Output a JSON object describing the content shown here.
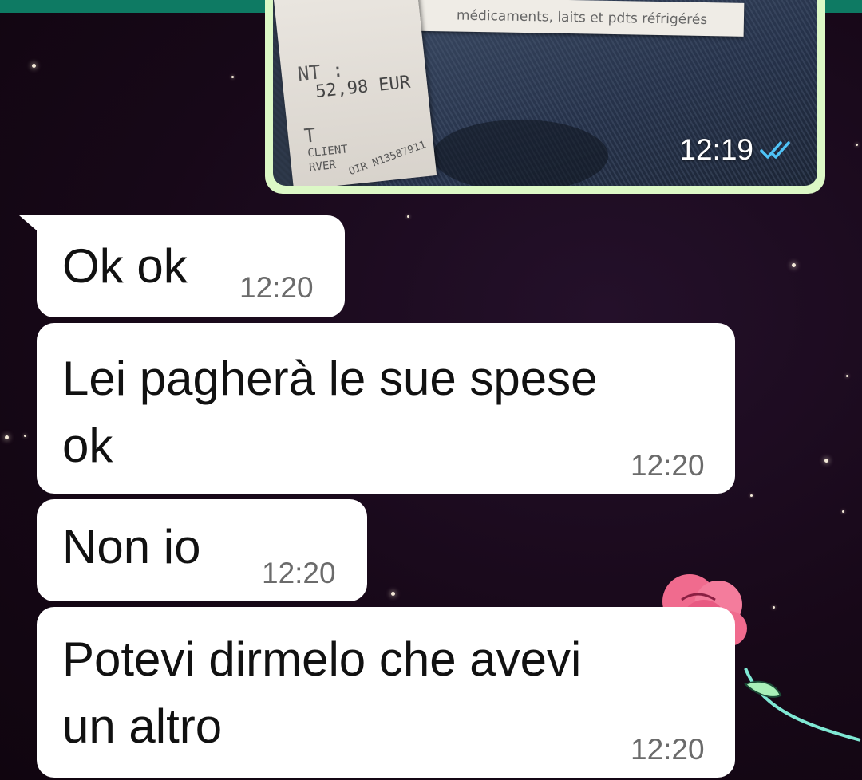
{
  "image_message": {
    "time": "12:19",
    "read_receipt_icon": "double-check-icon",
    "read_receipt_color": "#4fc3f7",
    "receipt_text": {
      "amount": "52,98 EUR",
      "label_nt": "NT :",
      "label_t": "T",
      "label_client": "CLIENT",
      "label_server": "RVER",
      "serial": "OIR N13587911",
      "footer": "médicaments, laits et pdts réfrigérés"
    }
  },
  "messages": [
    {
      "text_lines": [
        "Ok ok"
      ],
      "time": "12:20"
    },
    {
      "text_lines": [
        "Lei pagherà le sue spese",
        "ok"
      ],
      "time": "12:20"
    },
    {
      "text_lines": [
        "Non io"
      ],
      "time": "12:20"
    },
    {
      "text_lines": [
        "Potevi dirmelo che avevi",
        "un altro"
      ],
      "time": "12:20"
    }
  ],
  "colors": {
    "header": "#0e7a63",
    "outgoing_bubble": "#dcf8c6",
    "incoming_bubble": "#ffffff",
    "wallpaper": "#1a0a1c",
    "rose": "#f06b8e"
  }
}
